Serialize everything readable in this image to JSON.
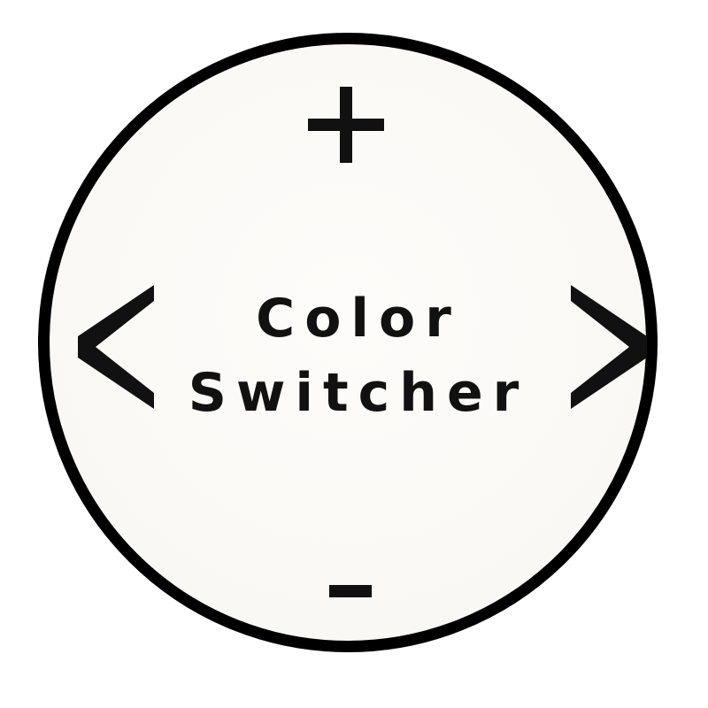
{
  "widget": {
    "title_line1": "Color",
    "title_line2": "Switcher",
    "increase_label": "+",
    "decrease_label": "-",
    "previous_label": "<",
    "next_label": ">"
  },
  "colors": {
    "ring": "#000000",
    "face": "#fbf9f6",
    "glyph": "#111111"
  },
  "icons": {
    "increase": "plus-icon",
    "decrease": "minus-icon",
    "previous": "chevron-left-icon",
    "next": "chevron-right-icon"
  }
}
